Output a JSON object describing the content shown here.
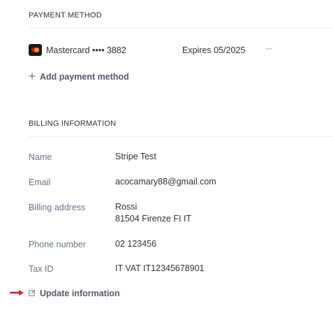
{
  "payment_method": {
    "title": "PAYMENT METHOD",
    "card": {
      "brand": "Mastercard •••• 3882",
      "expiry": "Expires 05/2025",
      "more": "···",
      "logo_icon": "mastercard-logo",
      "colors": {
        "red": "#eb001b",
        "orange": "#f79e1b",
        "bg": "#1a1a1a"
      }
    },
    "add_label": "Add payment method",
    "add_icon": "plus-icon"
  },
  "billing": {
    "title": "BILLING INFORMATION",
    "rows": [
      {
        "label": "Name",
        "value": "Stripe Test"
      },
      {
        "label": "Email",
        "value": "acocamary88@gmail.com"
      },
      {
        "label": "Billing address",
        "value_line1": "Rossi",
        "value_line2": "81504 Firenze FI IT"
      },
      {
        "label": "Phone number",
        "value": "02 123456"
      },
      {
        "label": "Tax ID",
        "value": "IT VAT IT12345678901"
      }
    ],
    "update_label": "Update information",
    "update_icon": "edit-icon"
  },
  "annotation": {
    "arrow_icon": "red-arrow-icon",
    "arrow_color": "#e0141e"
  }
}
